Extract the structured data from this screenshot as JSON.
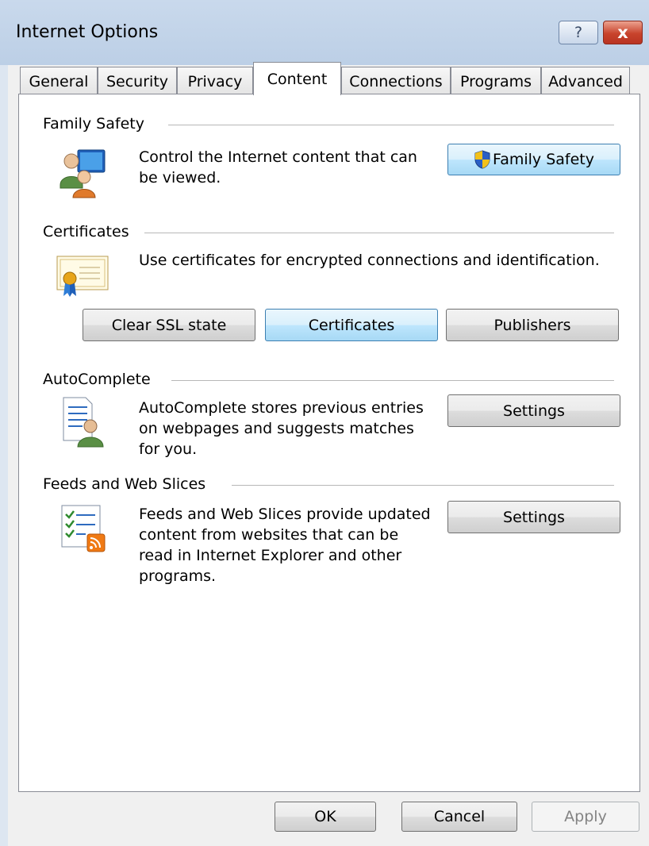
{
  "window": {
    "title": "Internet Options",
    "help_label": "?",
    "close_label": "x"
  },
  "tabs": [
    {
      "label": "General",
      "active": false
    },
    {
      "label": "Security",
      "active": false
    },
    {
      "label": "Privacy",
      "active": false
    },
    {
      "label": "Content",
      "active": true
    },
    {
      "label": "Connections",
      "active": false
    },
    {
      "label": "Programs",
      "active": false
    },
    {
      "label": "Advanced",
      "active": false
    }
  ],
  "family_safety": {
    "heading": "Family Safety",
    "description": [
      "Control the Internet content that can",
      "be viewed."
    ],
    "button_label": "Family Safety",
    "icon": "family-safety-users-icon"
  },
  "certificates": {
    "heading": "Certificates",
    "description": "Use certificates for encrypted connections and identification.",
    "icon": "certificate-icon",
    "buttons": {
      "clear_ssl": "Clear SSL state",
      "certificates": "Certificates",
      "publishers": "Publishers"
    }
  },
  "autocomplete": {
    "heading": "AutoComplete",
    "description": [
      "AutoComplete stores previous entries",
      "on webpages and suggests matches",
      "for you."
    ],
    "button_label": "Settings",
    "icon": "autocomplete-icon"
  },
  "feeds": {
    "heading": "Feeds and Web Slices",
    "description": [
      "Feeds and Web Slices provide updated",
      "content from websites that can be",
      "read in Internet Explorer and other",
      "programs."
    ],
    "button_label": "Settings",
    "icon": "feeds-rss-icon"
  },
  "footer": {
    "ok": "OK",
    "cancel": "Cancel",
    "apply": "Apply",
    "apply_enabled": false
  },
  "colors": {
    "title_bar": "#bccfe6",
    "close_button": "#c8432c",
    "hot_button": "#bee6fd"
  }
}
